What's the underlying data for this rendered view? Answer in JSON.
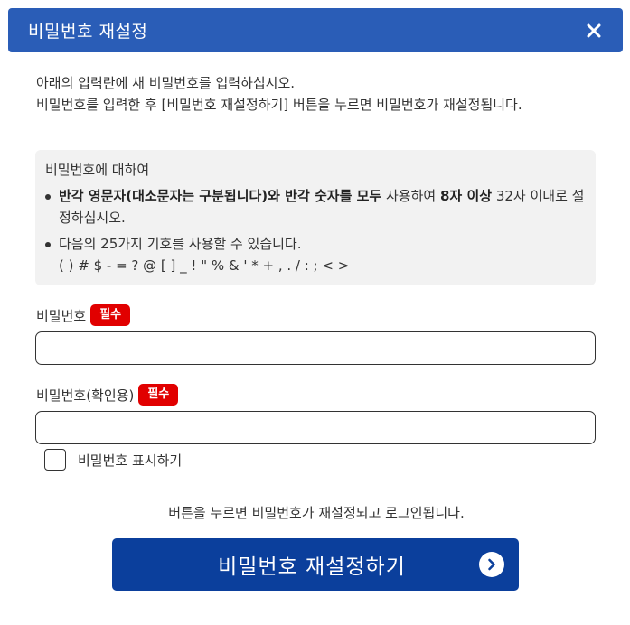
{
  "dialog": {
    "title": "비밀번호 재설정",
    "close_icon": "close-icon"
  },
  "intro": {
    "line1": "아래의 입력란에 새 비밀번호를 입력하십시오.",
    "line2": "비밀번호를 입력한 후 [비밀번호 재설정하기] 버튼을 누르면 비밀번호가 재설정됩니다."
  },
  "info": {
    "title": "비밀번호에 대하여",
    "rule1_part1": "반각 영문자(대소문자는 구분됩니다)와 반각 숫자를 모두",
    "rule1_part2": " 사용하여 ",
    "rule1_part3": "8자 이상",
    "rule1_part4": " 32자 이내로 설정하십시오.",
    "rule2_line1": "다음의 25가지 기호를 사용할 수 있습니다.",
    "rule2_symbols": "( ) # $ - = ? @ [ ] _ ! \" % & ' * + , . / : ; < >"
  },
  "password": {
    "label": "비밀번호",
    "required": "필수",
    "value": "",
    "placeholder": ""
  },
  "password_confirm": {
    "label": "비밀번호(확인용)",
    "required": "필수",
    "value": "",
    "placeholder": ""
  },
  "show_password": {
    "label": "비밀번호 표시하기",
    "checked": false
  },
  "note": "버튼을 누르면 비밀번호가 재설정되고 로그인됩니다.",
  "submit": {
    "label": "비밀번호 재설정하기",
    "icon": "chevron-right-circle-icon"
  },
  "colors": {
    "header_bg": "#2a5db7",
    "button_bg": "#0b3f9c",
    "required_badge": "#e10000",
    "info_bg": "#f2f2f2"
  }
}
